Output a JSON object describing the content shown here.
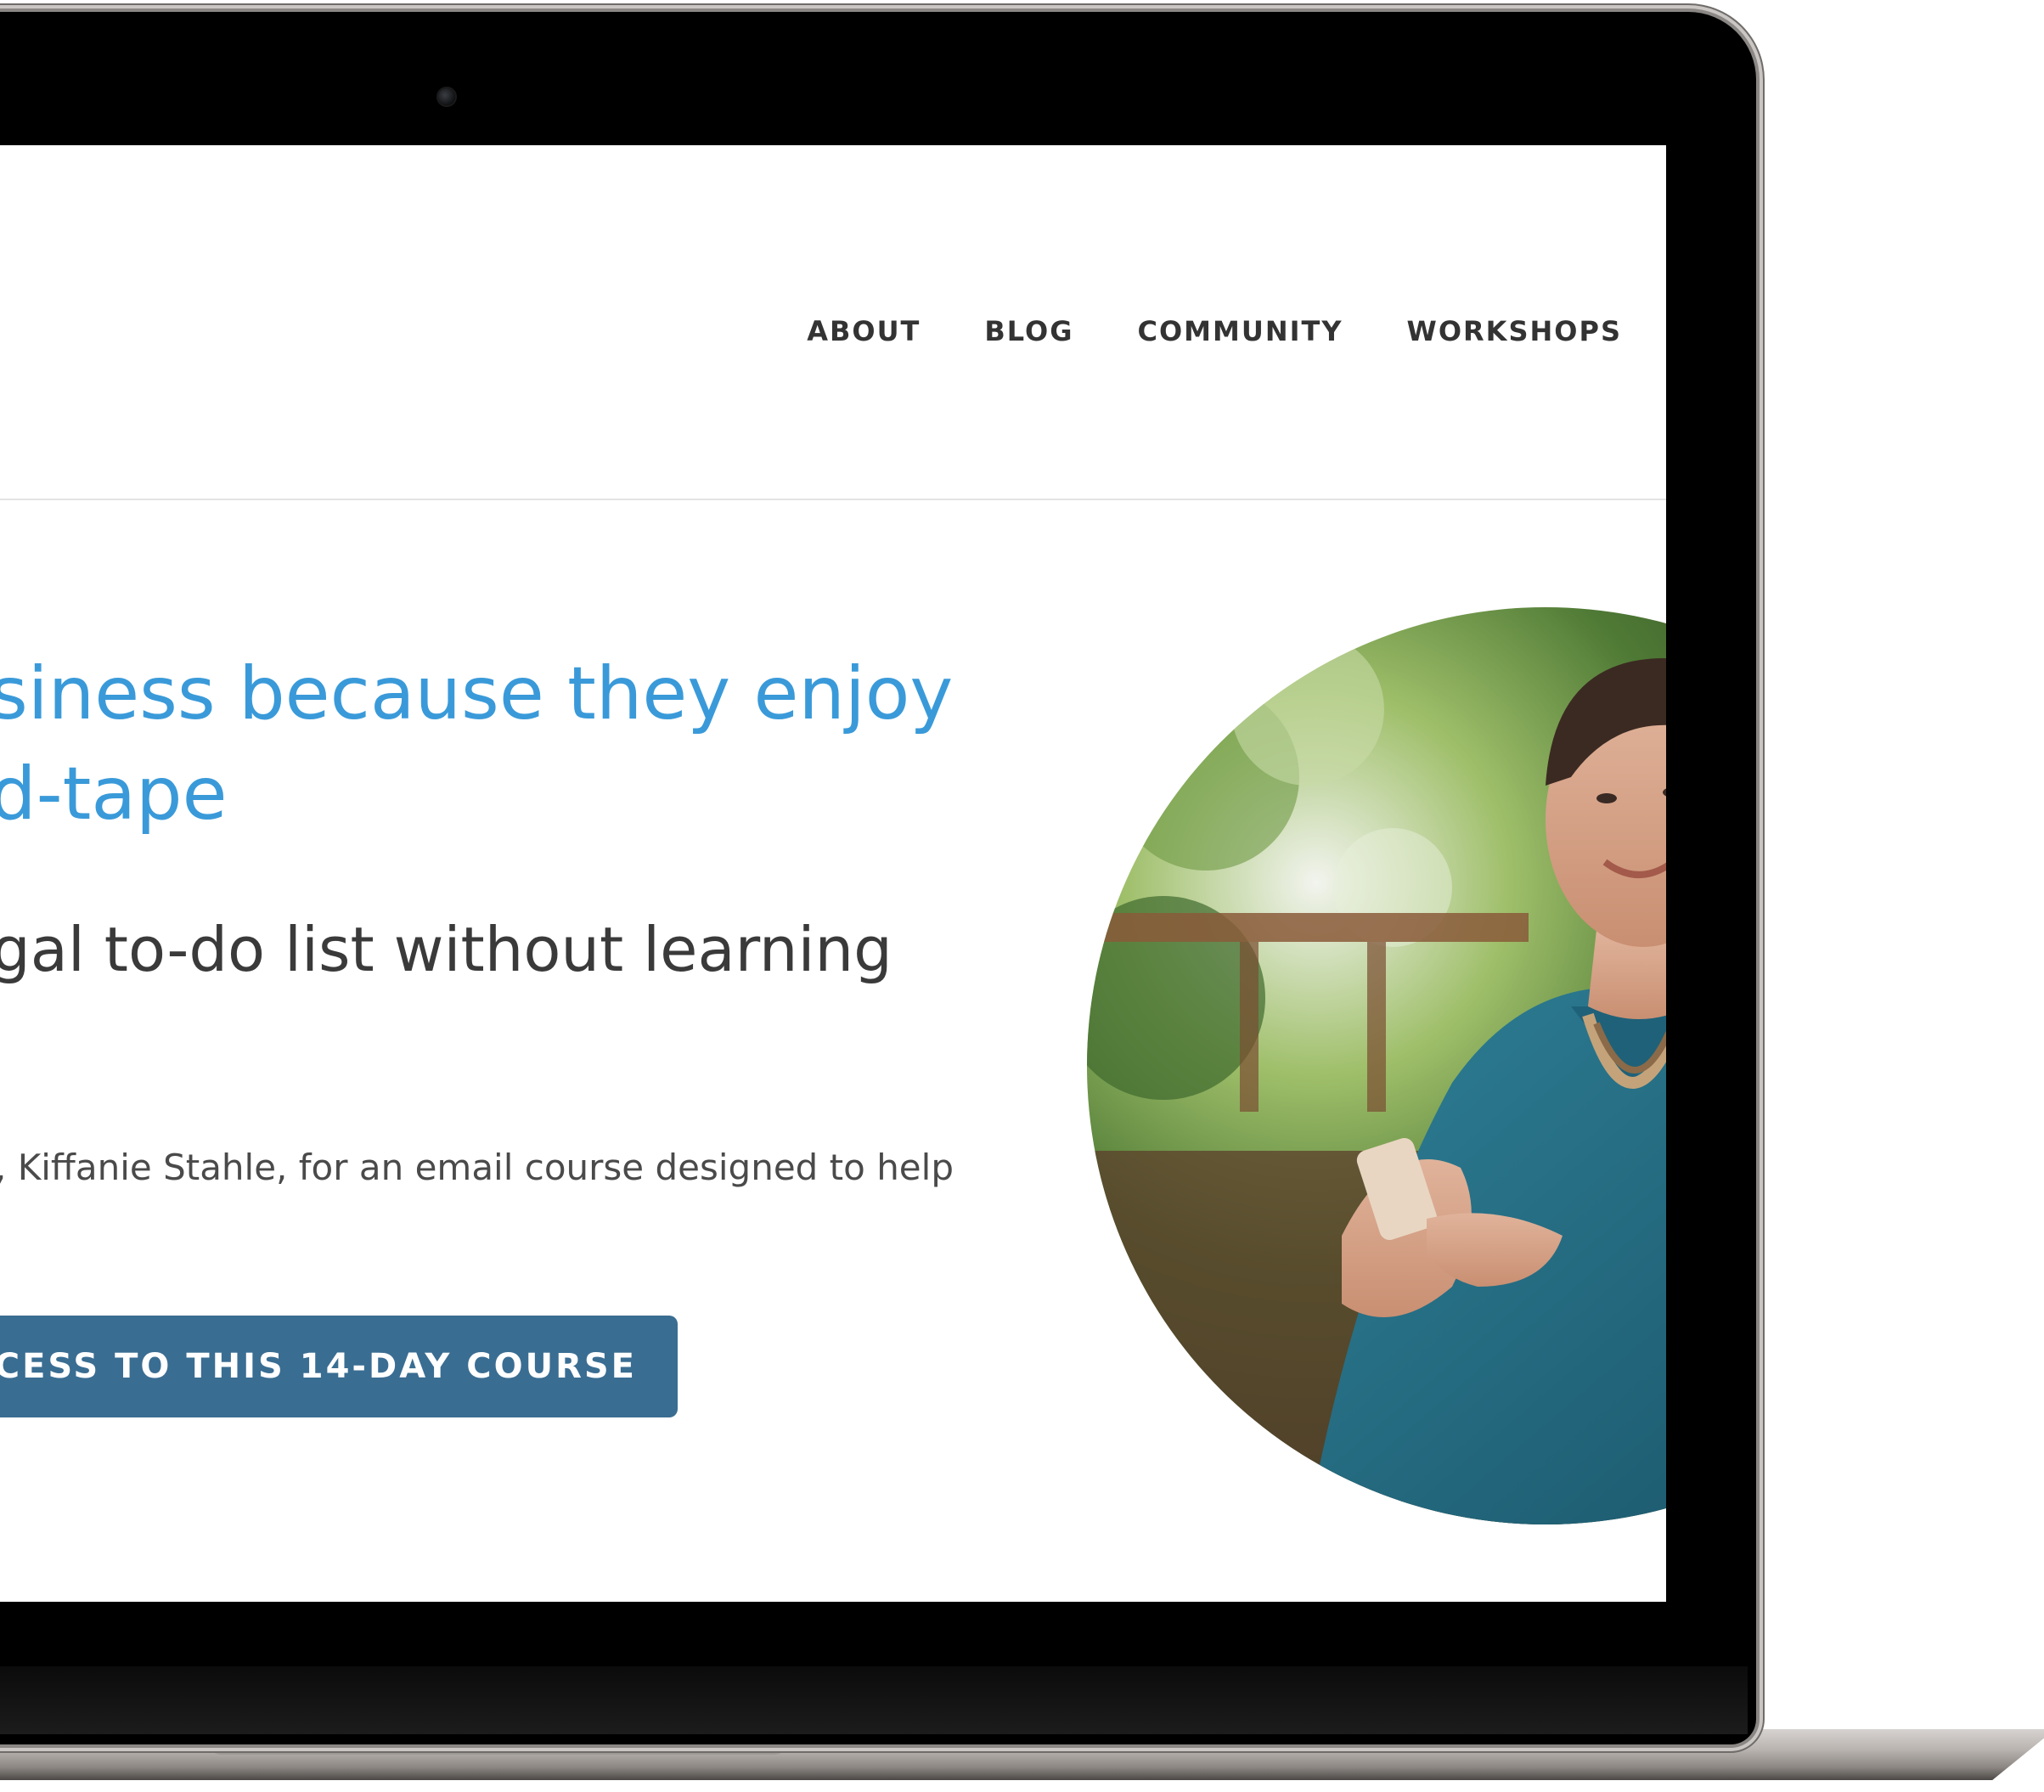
{
  "nav": {
    "items": [
      {
        "label": "ABOUT"
      },
      {
        "label": "BLOG"
      },
      {
        "label": "COMMUNITY"
      },
      {
        "label": "WORKSHOPS"
      }
    ]
  },
  "hero": {
    "headline_line1": "siness because they enjoy",
    "headline_line2": "d-tape",
    "subhead": "gal to-do list without learning",
    "intro": ", Kiffanie Stahle, for an email course designed to help",
    "cta_label": "CCESS TO THIS 14-DAY COURSE"
  },
  "colors": {
    "headline": "#3a9ad9",
    "cta_background": "#3a6d92",
    "nav_text": "#333333",
    "bezel": "#000000"
  }
}
